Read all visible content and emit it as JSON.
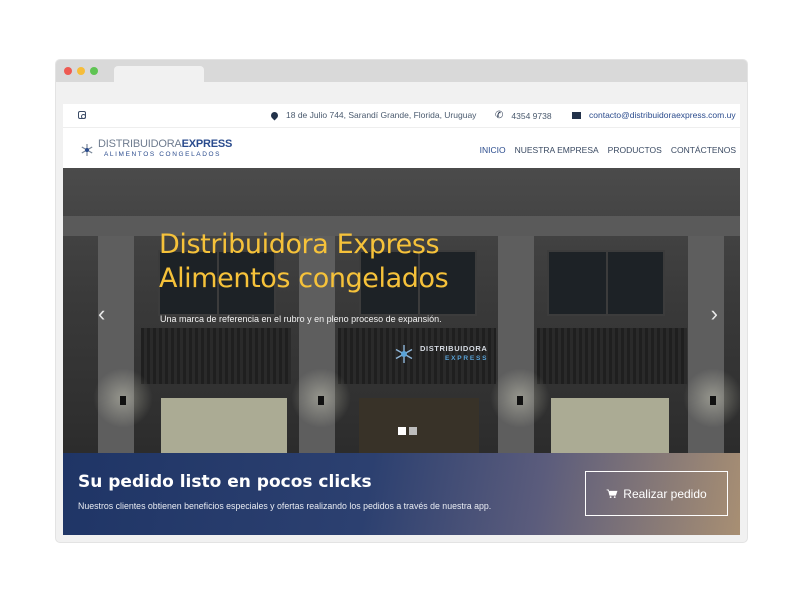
{
  "topbar": {
    "address": "18 de Julio 744, Sarandí Grande, Florida, Uruguay",
    "phone": "4354 9738",
    "email": "contacto@distribuidoraexpress.com.uy"
  },
  "logo": {
    "name_light": "DISTRIBUIDORA",
    "name_bold": "EXPRESS",
    "subtitle": "ALIMENTOS CONGELADOS"
  },
  "nav": {
    "items": [
      {
        "label": "INICIO",
        "active": true
      },
      {
        "label": "NUESTRA EMPRESA",
        "active": false
      },
      {
        "label": "PRODUCTOS",
        "active": false
      },
      {
        "label": "CONTÁCTENOS",
        "active": false
      }
    ]
  },
  "hero": {
    "title_line1": "Distribuidora Express",
    "title_line2": "Alimentos congelados",
    "subtitle": "Una marca de referencia en el rubro y en pleno proceso de expansión.",
    "sign_line1": "DISTRIBUIDORA",
    "sign_line2": "EXPRESS",
    "prev_arrow": "‹",
    "next_arrow": "›",
    "slide_count": 2,
    "active_slide": 1
  },
  "cta": {
    "title": "Su pedido listo en pocos clicks",
    "text": "Nuestros clientes obtienen beneficios especiales y ofertas realizando los pedidos a través de nuestra app.",
    "button_label": "Realizar pedido"
  },
  "colors": {
    "accent_yellow": "#f6c23a",
    "brand_blue": "#2a4b8d",
    "cta_blue": "#1f3566"
  },
  "icons": [
    "instagram-icon",
    "map-pin-icon",
    "phone-icon",
    "envelope-icon",
    "cart-icon",
    "chevron-left-icon",
    "chevron-right-icon"
  ]
}
